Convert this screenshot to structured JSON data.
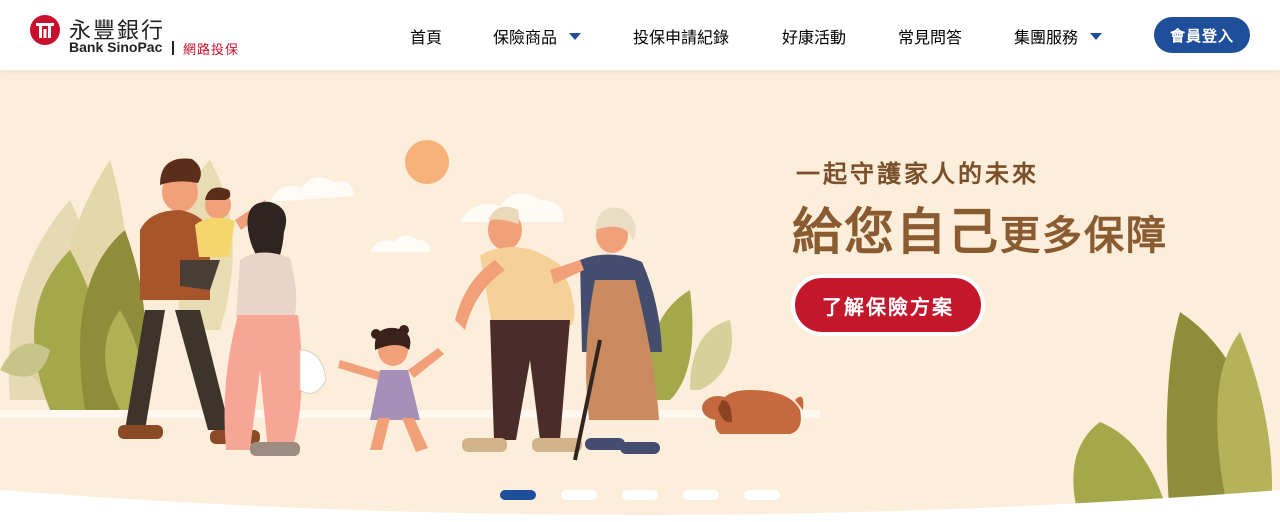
{
  "header": {
    "logo_cn": "永豐銀行",
    "logo_en": "Bank SinoPac",
    "logo_sub": "網路投保",
    "nav": [
      {
        "label": "首頁",
        "has_caret": false
      },
      {
        "label": "保險商品",
        "has_caret": true
      },
      {
        "label": "投保申請紀錄",
        "has_caret": false
      },
      {
        "label": "好康活動",
        "has_caret": false
      },
      {
        "label": "常見問答",
        "has_caret": false
      },
      {
        "label": "集團服務",
        "has_caret": true
      }
    ],
    "login_label": "會員登入"
  },
  "hero": {
    "tagline": "一起守護家人的未來",
    "headline_big": "給您自己",
    "headline_small": "更多保障",
    "cta_label": "了解保險方案",
    "carousel": {
      "count": 5,
      "active_index": 0
    }
  },
  "colors": {
    "brand_blue": "#1f4e9b",
    "brand_red": "#c4172c",
    "hero_bg": "#fdeedb",
    "headline_brown": "#8a5a30"
  },
  "icons": [
    "sinopac-logo-icon",
    "chevron-down-icon"
  ]
}
